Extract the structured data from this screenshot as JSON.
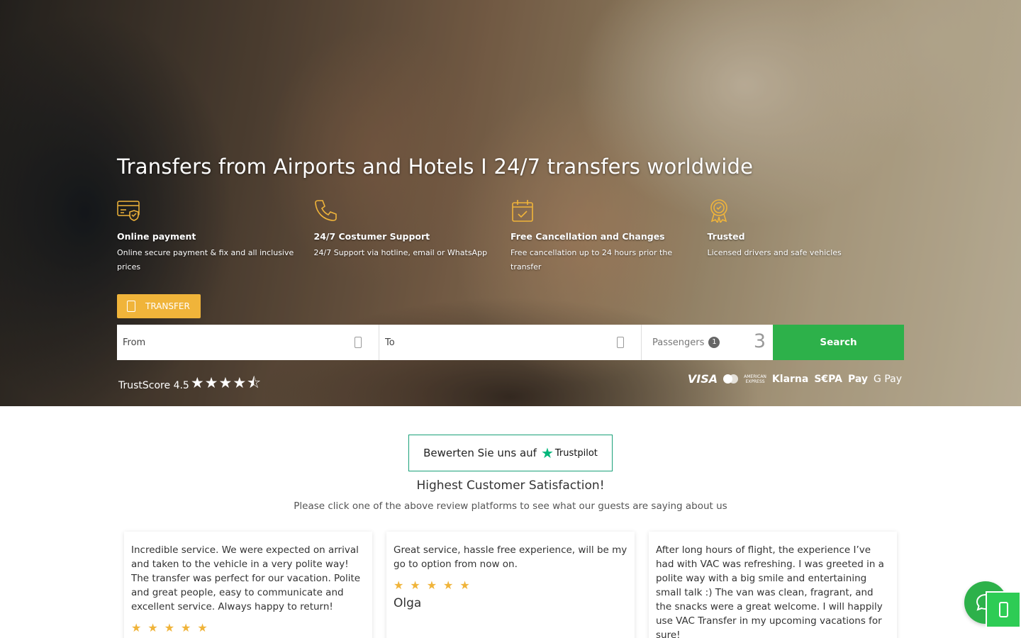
{
  "hero": {
    "title": "Transfers from Airports and Hotels I 24/7 transfers worldwide",
    "features": [
      {
        "icon": "credit-card-shield-icon",
        "title": "Online payment",
        "desc": "Online secure payment & fix and all inclusive prices"
      },
      {
        "icon": "phone-icon",
        "title": "24/7 Costumer Support",
        "desc": "24/7 Support via hotline, email or WhatsApp"
      },
      {
        "icon": "calendar-check-icon",
        "title": "Free Cancellation and Changes",
        "desc": "Free cancellation up to 24 hours prior the transfer"
      },
      {
        "icon": "award-badge-icon",
        "title": "Trusted",
        "desc": "Licensed drivers and safe vehicles"
      }
    ],
    "accent_color": "#f0b43a"
  },
  "search": {
    "tab_label": "TRANSFER",
    "from_placeholder": "From",
    "to_placeholder": "To",
    "passengers_label": "Passengers",
    "passengers_badge": "1",
    "passengers_count": "3",
    "search_label": "Search",
    "search_color": "#2db14a"
  },
  "trust": {
    "label": "TrustScore 4.5",
    "stars": "★★★★⯪",
    "rating": 4.5
  },
  "payments": {
    "visa": "VISA",
    "amex_top": "AMERICAN",
    "amex_bottom": "EXPRESS",
    "klarna": "Klarna",
    "sepa": "S€PA",
    "applepay": "Pay",
    "gpay": "G Pay"
  },
  "trustpilot": {
    "prefix": "Bewerten Sie uns auf",
    "brand": "Trustpilot"
  },
  "satisfaction": {
    "title": "Highest Customer Satisfaction!",
    "subtitle": "Please click one of the above review platforms to see what our guests are saying about us"
  },
  "reviews": [
    {
      "text": "Incredible service. We were expected on arrival and taken to the vehicle in a very polite way! The transfer was perfect for our vacation. Polite and great people, easy to communicate and excellent service. Always happy to return!",
      "stars": "★★★★★",
      "name": ""
    },
    {
      "text": "Great service, hassle free experience, will be my go to option from now on.",
      "stars": "★★★★★",
      "name": "Olga"
    },
    {
      "text": "After long hours of flight, the experience I’ve had with VAC was refreshing. I was greeted in a polite way with a big smile and entertaining small talk :) The van was clean, fragrant, and the snacks were a great welcome. I will happily use VAC Transfer in my upcoming vacations for sure!",
      "stars": "★★★★★",
      "name": ""
    }
  ]
}
